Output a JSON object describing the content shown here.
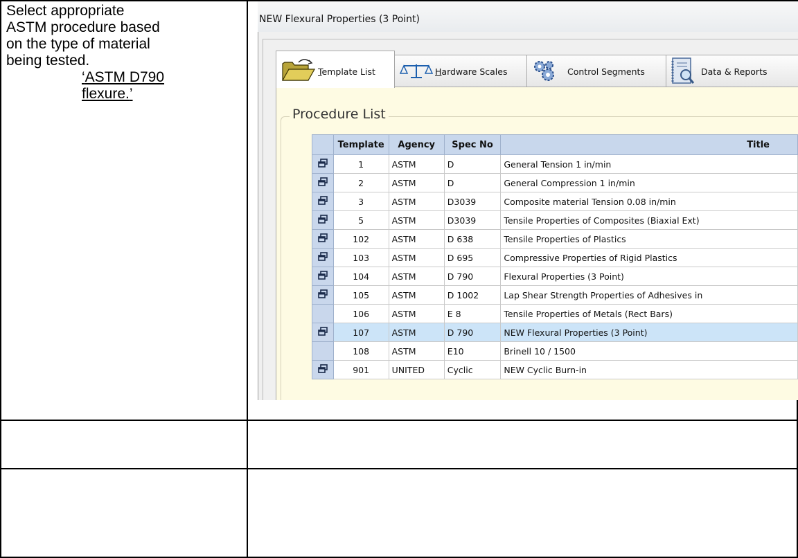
{
  "instructions": {
    "lines": [
      "Select appropriate",
      "ASTM procedure based",
      "on the type of material",
      "being tested."
    ],
    "reference_line1": "ASTM D790",
    "reference_line2": "flexure.",
    "open_quote": "‘",
    "close_quote": "’"
  },
  "window": {
    "title": "NEW Flexural Properties (3 Point)"
  },
  "tabs": [
    {
      "label": "Template List",
      "underline": "T",
      "rest": "emplate List",
      "icon": "folder-icon",
      "active": true
    },
    {
      "label": "Hardware Scales",
      "underline": "H",
      "rest": "ardware Scales",
      "icon": "scales-icon",
      "active": false
    },
    {
      "label": "Control Segments",
      "icon": "gears-icon",
      "active": false
    },
    {
      "label": "Data & Reports",
      "icon": "report-icon",
      "active": false
    }
  ],
  "procedure_list": {
    "title": "Procedure List",
    "columns": [
      "Template",
      "Agency",
      "Spec No",
      "Title"
    ],
    "rows": [
      {
        "template": "1",
        "agency": "ASTM",
        "spec": "D",
        "title": "General Tension 1 in/min",
        "has_icon": true,
        "selected": false
      },
      {
        "template": "2",
        "agency": "ASTM",
        "spec": "D",
        "title": "General Compression 1 in/min",
        "has_icon": true,
        "selected": false
      },
      {
        "template": "3",
        "agency": "ASTM",
        "spec": "D3039",
        "title": "Composite material Tension 0.08 in/min",
        "has_icon": true,
        "selected": false
      },
      {
        "template": "5",
        "agency": "ASTM",
        "spec": "D3039",
        "title": "Tensile Properties of Composites (Biaxial Ext)",
        "has_icon": true,
        "selected": false
      },
      {
        "template": "102",
        "agency": "ASTM",
        "spec": "D 638",
        "title": "Tensile Properties of Plastics",
        "has_icon": true,
        "selected": false
      },
      {
        "template": "103",
        "agency": "ASTM",
        "spec": "D 695",
        "title": "Compressive Properties of Rigid Plastics",
        "has_icon": true,
        "selected": false
      },
      {
        "template": "104",
        "agency": "ASTM",
        "spec": "D 790",
        "title": "Flexural Properties (3 Point)",
        "has_icon": true,
        "selected": false
      },
      {
        "template": "105",
        "agency": "ASTM",
        "spec": "D 1002",
        "title": "Lap Shear Strength Properties of Adhesives in",
        "has_icon": true,
        "selected": false
      },
      {
        "template": "106",
        "agency": "ASTM",
        "spec": "E 8",
        "title": "Tensile Properties of Metals (Rect Bars)",
        "has_icon": false,
        "selected": false
      },
      {
        "template": "107",
        "agency": "ASTM",
        "spec": "D 790",
        "title": "NEW Flexural Properties (3 Point)",
        "has_icon": true,
        "selected": true
      },
      {
        "template": "108",
        "agency": "ASTM",
        "spec": "E10",
        "title": "Brinell 10 / 1500",
        "has_icon": false,
        "selected": false
      },
      {
        "template": "901",
        "agency": "UNITED",
        "spec": "Cyclic",
        "title": "NEW Cyclic Burn-in",
        "has_icon": true,
        "selected": false
      }
    ]
  },
  "colors": {
    "tab_page_bg": "#fefbe3",
    "header_bg": "#c8d7ec",
    "selected_row_bg": "#cce4f8"
  }
}
